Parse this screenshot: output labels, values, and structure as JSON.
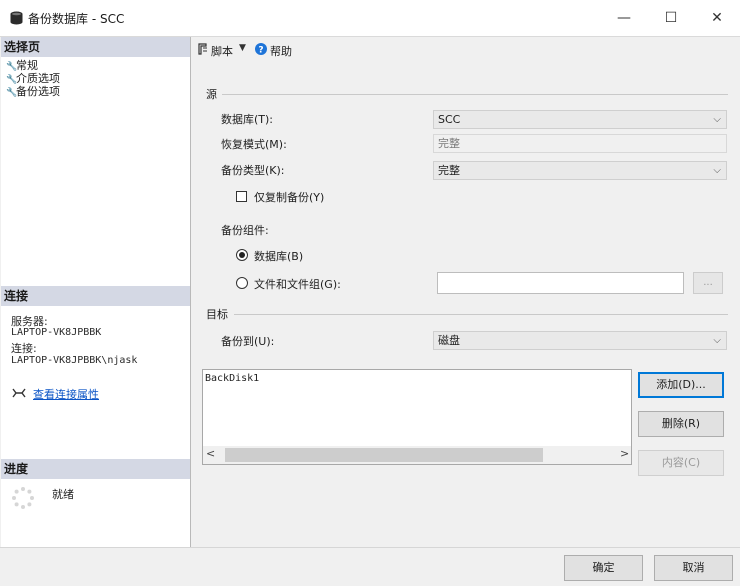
{
  "window": {
    "title": "备份数据库 - SCC",
    "minimize_glyph": "—",
    "maximize_glyph": "☐",
    "close_glyph": "✕"
  },
  "left": {
    "select_page_header": "选择页",
    "pages": [
      {
        "label": "常规",
        "icon": "wrench-icon"
      },
      {
        "label": "介质选项",
        "icon": "wrench-icon"
      },
      {
        "label": "备份选项",
        "icon": "wrench-icon"
      }
    ],
    "connection_header": "连接",
    "server_label": "服务器:",
    "server_value": "LAPTOP-VK8JPBBK",
    "connection_label": "连接:",
    "connection_value": "LAPTOP-VK8JPBBK\\njask",
    "view_connection_link": "查看连接属性",
    "progress_header": "进度",
    "progress_status": "就绪"
  },
  "toolbar": {
    "script_label": "脚本",
    "help_label": "帮助"
  },
  "source": {
    "group_label": "源",
    "database_label": "数据库(T):",
    "database_value": "SCC",
    "recovery_label": "恢复模式(M):",
    "recovery_value": "完整",
    "backup_type_label": "备份类型(K):",
    "backup_type_value": "完整",
    "copy_only_label": "仅复制备份(Y)",
    "copy_only_checked": false,
    "component_label": "备份组件:",
    "component_options": [
      {
        "label": "数据库(B)",
        "selected": true
      },
      {
        "label": "文件和文件组(G):",
        "selected": false
      }
    ],
    "files_browse_label": "..."
  },
  "destination": {
    "group_label": "目标",
    "backup_to_label": "备份到(U):",
    "backup_to_value": "磁盘",
    "list_items": [
      "BackDisk1"
    ],
    "add_button": "添加(D)...",
    "remove_button": "删除(R)",
    "contents_button": "内容(C)"
  },
  "footer": {
    "ok_button": "确定",
    "cancel_button": "取消"
  },
  "colors": {
    "section_header": "#d4d8e4",
    "link": "#0b54c6",
    "accent": "#0078d7"
  }
}
